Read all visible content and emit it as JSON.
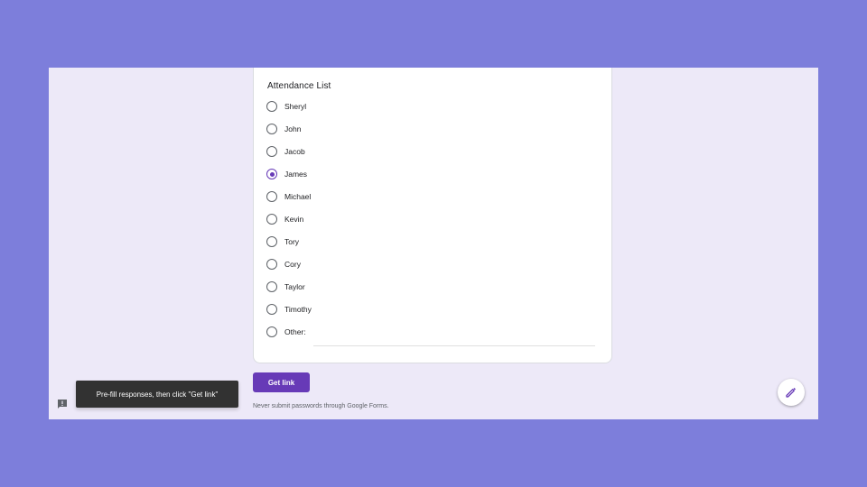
{
  "form": {
    "question_title": "Attendance List",
    "options": [
      {
        "label": "Sheryl",
        "checked": false
      },
      {
        "label": "John",
        "checked": false
      },
      {
        "label": "Jacob",
        "checked": false
      },
      {
        "label": "James",
        "checked": true
      },
      {
        "label": "Michael",
        "checked": false
      },
      {
        "label": "Kevin",
        "checked": false
      },
      {
        "label": "Tory",
        "checked": false
      },
      {
        "label": "Cory",
        "checked": false
      },
      {
        "label": "Taylor",
        "checked": false
      },
      {
        "label": "Timothy",
        "checked": false
      },
      {
        "label": "Other:",
        "checked": false
      }
    ],
    "other_value": ""
  },
  "actions": {
    "get_link_label": "Get link"
  },
  "footer": {
    "disclaimer": "Never submit passwords through Google Forms."
  },
  "toast": {
    "message": "Pre-fill responses, then click \"Get link\""
  },
  "icons": {
    "feedback": "feedback-icon",
    "edit": "pencil-icon"
  },
  "colors": {
    "background": "#7d7edb",
    "frame": "#ede9f8",
    "accent": "#673ab7",
    "toast": "#323232"
  }
}
